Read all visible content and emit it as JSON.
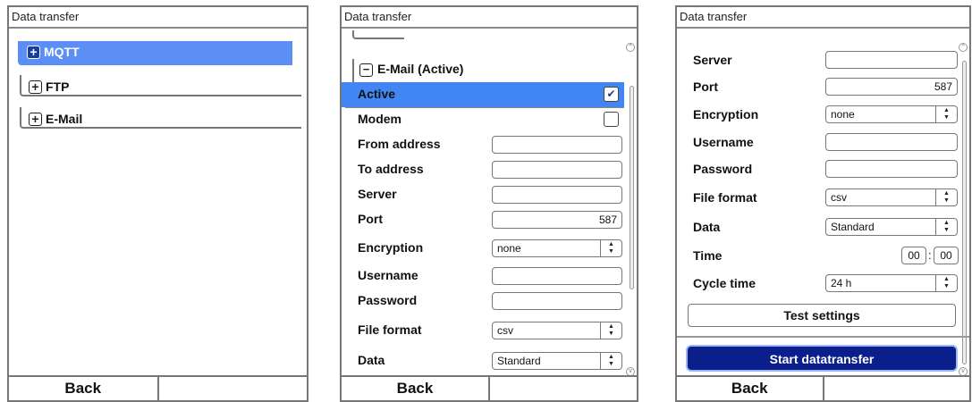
{
  "screen1": {
    "title": "Data transfer",
    "items": [
      {
        "label": "MQTT",
        "icon": "plus-icon",
        "selected": true
      },
      {
        "label": "FTP",
        "icon": "plus-icon",
        "selected": false
      },
      {
        "label": "E-Mail",
        "icon": "plus-icon",
        "selected": false
      }
    ],
    "softkeys": {
      "left": "Back",
      "right": ""
    }
  },
  "screen2": {
    "title": "Data transfer",
    "group_label": "E-Mail (Active)",
    "group_icon": "minus-icon",
    "rows": {
      "active": {
        "label": "Active",
        "checked": true
      },
      "modem": {
        "label": "Modem",
        "checked": false
      },
      "from": {
        "label": "From address",
        "value": ""
      },
      "to": {
        "label": "To address",
        "value": ""
      },
      "server": {
        "label": "Server",
        "value": ""
      },
      "port": {
        "label": "Port",
        "value": "587"
      },
      "encryption": {
        "label": "Encryption",
        "value": "none"
      },
      "username": {
        "label": "Username",
        "value": ""
      },
      "password": {
        "label": "Password",
        "value": ""
      },
      "format": {
        "label": "File format",
        "value": "csv"
      },
      "data": {
        "label": "Data",
        "value": "Standard"
      }
    },
    "softkeys": {
      "left": "Back",
      "right": ""
    }
  },
  "screen3": {
    "title": "Data transfer",
    "rows": {
      "server": {
        "label": "Server",
        "value": ""
      },
      "port": {
        "label": "Port",
        "value": "587"
      },
      "encryption": {
        "label": "Encryption",
        "value": "none"
      },
      "username": {
        "label": "Username",
        "value": ""
      },
      "password": {
        "label": "Password",
        "value": ""
      },
      "format": {
        "label": "File format",
        "value": "csv"
      },
      "data": {
        "label": "Data",
        "value": "Standard"
      },
      "time": {
        "label": "Time",
        "hours": "00",
        "minutes": "00",
        "separator": ":"
      },
      "cycle": {
        "label": "Cycle time",
        "value": "24 h"
      }
    },
    "test_button": "Test settings",
    "start_button": "Start datatransfer",
    "softkeys": {
      "left": "Back",
      "right": ""
    }
  },
  "colors": {
    "selection": "#4286f4",
    "primary_button": "#0a1e8c",
    "tree_selected": "#5b8ff5"
  }
}
